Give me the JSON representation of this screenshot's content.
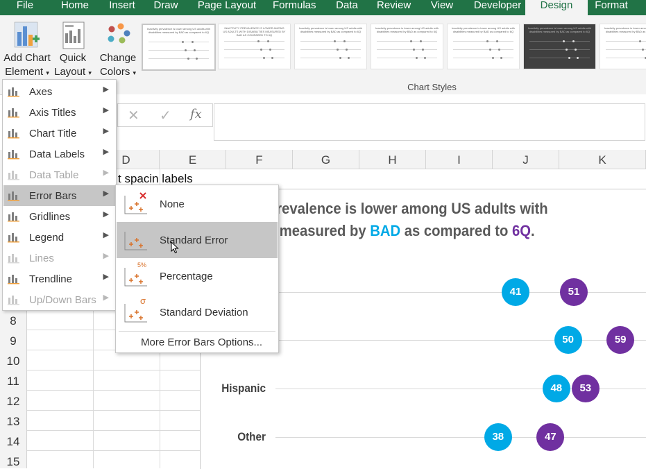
{
  "ribbon_tabs": [
    "File",
    "Home",
    "Insert",
    "Draw",
    "Page Layout",
    "Formulas",
    "Data",
    "Review",
    "View",
    "Developer",
    "Design",
    "Format"
  ],
  "active_tab": "Design",
  "ribbon": {
    "add_chart_element": {
      "line1": "Add Chart",
      "line2": "Element"
    },
    "quick_layout": {
      "line1": "Quick",
      "line2": "Layout"
    },
    "change_colors": {
      "line1": "Change",
      "line2": "Colors"
    },
    "gallery_label": "Chart Styles",
    "style_thumbnails": [
      {
        "title": "Inactivity prevalence is lower among US adults with disabilities measured by BAD as compared to 6Q",
        "dark": false
      },
      {
        "title": "INACTIVITY PREVALENCE IS LOWER AMONG US ADULTS WITH DISABILITIES MEASURED BY BAD AS COMPARED TO 6Q",
        "dark": false
      },
      {
        "title": "Inactivity prevalence is lower among US adults with disabilities measured by BAD as compared to 6Q",
        "dark": false
      },
      {
        "title": "Inactivity prevalence is lower among US adults with disabilities measured by BAD as compared to 6Q",
        "dark": false
      },
      {
        "title": "Inactivity prevalence is lower among US adults with disabilities measured by BAD as compared to 6Q",
        "dark": false
      },
      {
        "title": "Inactivity prevalence is lower among US adults with disabilities measured by BAD as compared to 6Q",
        "dark": true
      },
      {
        "title": "Inactivity prevalence is lower among US adults with disabilities measured by BAD as compared to 6Q",
        "dark": false
      }
    ]
  },
  "formula_bar": {
    "cancel": "✕",
    "enter": "✓",
    "fx": "fx",
    "value": ""
  },
  "columns": [
    "D",
    "E",
    "F",
    "G",
    "H",
    "I",
    "J",
    "K"
  ],
  "rows": [
    "8",
    "9",
    "10",
    "11",
    "12",
    "13",
    "14",
    "15"
  ],
  "cell_text": "t spacin labels",
  "menu": {
    "items": [
      {
        "label": "Axes",
        "disabled": false,
        "highlighted": false
      },
      {
        "label": "Axis Titles",
        "disabled": false,
        "highlighted": false
      },
      {
        "label": "Chart Title",
        "disabled": false,
        "highlighted": false
      },
      {
        "label": "Data Labels",
        "disabled": false,
        "highlighted": false
      },
      {
        "label": "Data Table",
        "disabled": true,
        "highlighted": false
      },
      {
        "label": "Error Bars",
        "disabled": false,
        "highlighted": true
      },
      {
        "label": "Gridlines",
        "disabled": false,
        "highlighted": false
      },
      {
        "label": "Legend",
        "disabled": false,
        "highlighted": false
      },
      {
        "label": "Lines",
        "disabled": true,
        "highlighted": false
      },
      {
        "label": "Trendline",
        "disabled": false,
        "highlighted": false
      },
      {
        "label": "Up/Down Bars",
        "disabled": true,
        "highlighted": false
      }
    ]
  },
  "submenu": {
    "items": [
      {
        "label": "None",
        "highlighted": false
      },
      {
        "label": "Standard Error",
        "highlighted": true
      },
      {
        "label": "Percentage",
        "highlighted": false
      },
      {
        "label": "Standard Deviation",
        "highlighted": false
      }
    ],
    "more": "More Error Bars Options...",
    "percent_badge": "5%",
    "sigma_badge": "σ"
  },
  "colors": {
    "bad": "#00a9e6",
    "six_q": "#7030a0",
    "excel_green": "#217346"
  },
  "chart_data": {
    "type": "scatter",
    "title_parts": [
      {
        "text": "y prevalence is lower among US adults with",
        "class": ""
      },
      {
        "text": "ies measured by ",
        "class": ""
      },
      {
        "text": "BAD",
        "class": "bad"
      },
      {
        "text": " as compared to ",
        "class": ""
      },
      {
        "text": "6Q",
        "class": "six"
      },
      {
        "text": ".",
        "class": ""
      }
    ],
    "categories": [
      "",
      "",
      "Hispanic",
      "Other"
    ],
    "series": [
      {
        "name": "BAD",
        "values": [
          41,
          50,
          48,
          38
        ],
        "color": "#00a9e6"
      },
      {
        "name": "6Q",
        "values": [
          51,
          59,
          53,
          47
        ],
        "color": "#7030a0"
      }
    ]
  }
}
